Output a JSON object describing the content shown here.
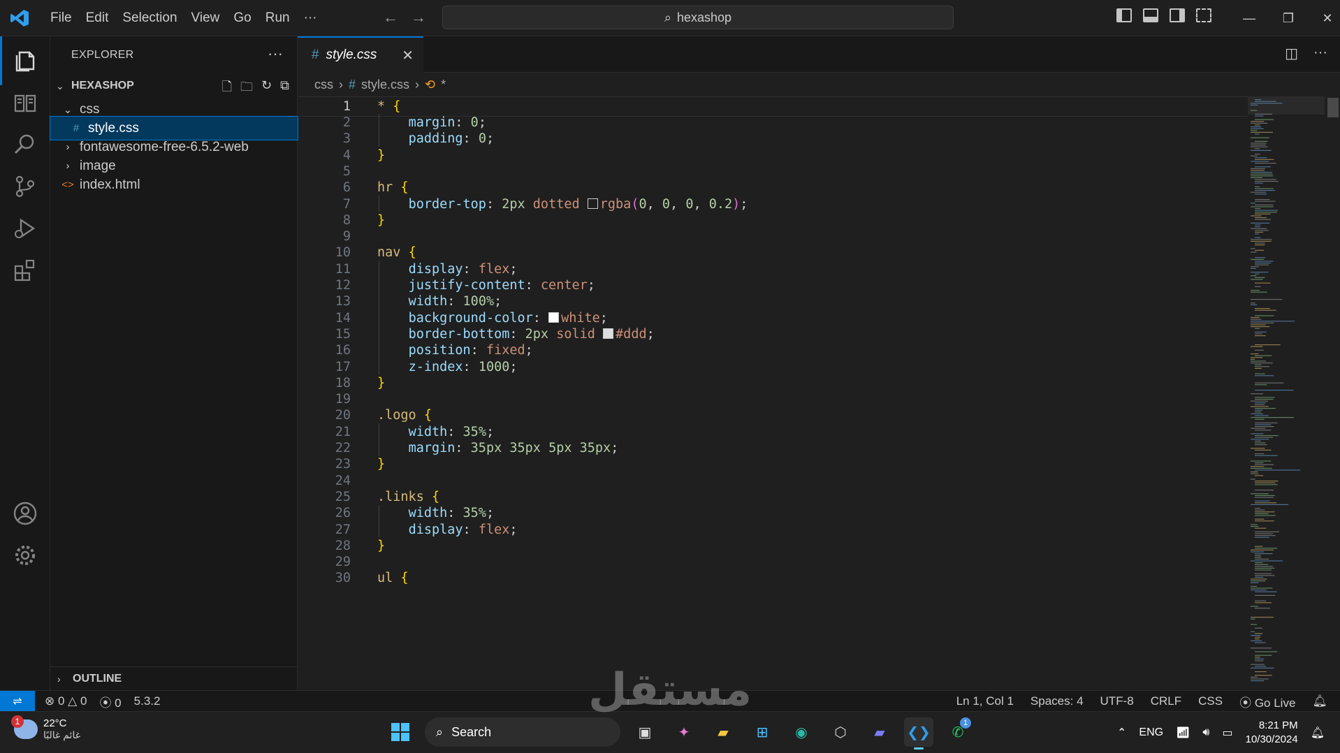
{
  "menu": [
    "File",
    "Edit",
    "Selection",
    "View",
    "Go",
    "Run",
    "···"
  ],
  "command_center": {
    "text": "hexashop"
  },
  "explorer": {
    "title": "EXPLORER",
    "project": "HEXASHOP",
    "items": [
      {
        "label": "css",
        "kind": "folder-open",
        "indent": 1
      },
      {
        "label": "style.css",
        "kind": "css-file",
        "indent": 2
      },
      {
        "label": "fontawesome-free-6.5.2-web",
        "kind": "folder",
        "indent": 1
      },
      {
        "label": "image",
        "kind": "folder",
        "indent": 1
      },
      {
        "label": "index.html",
        "kind": "html-file",
        "indent": 1
      }
    ],
    "outline": "OUTLINE"
  },
  "tab": {
    "label": "style.css"
  },
  "breadcrumb": {
    "folder": "css",
    "file": "style.css",
    "symbol": "*"
  },
  "code_lines": [
    "* {",
    "    margin: 0;",
    "    padding: 0;",
    "}",
    "",
    "hr {",
    "    border-top: 2px dotted rgba(0, 0, 0, 0.2);",
    "}",
    "",
    "nav {",
    "    display: flex;",
    "    justify-content: center;",
    "    width: 100%;",
    "    background-color: white;",
    "    border-bottom: 2px solid #ddd;",
    "    position: fixed;",
    "    z-index: 1000;",
    "}",
    "",
    ".logo {",
    "    width: 35%;",
    "    margin: 35px 35px 5px 35px;",
    "}",
    "",
    ".links {",
    "    width: 35%;",
    "    display: flex;",
    "}",
    "",
    "ul {"
  ],
  "status": {
    "errors": "0",
    "warnings": "0",
    "ports": "0",
    "version": "5.3.2",
    "position": "Ln 1, Col 1",
    "spaces": "Spaces: 4",
    "encoding": "UTF-8",
    "eol": "CRLF",
    "language": "CSS",
    "golive": "Go Live"
  },
  "taskbar": {
    "weather_temp": "22°C",
    "weather_desc": "غائم غالبًا",
    "weather_badge": "1",
    "search": "Search",
    "lang": "ENG",
    "time": "8:21 PM",
    "date": "10/30/2024",
    "whatsapp_badge": "1"
  },
  "watermark": "مستقل"
}
